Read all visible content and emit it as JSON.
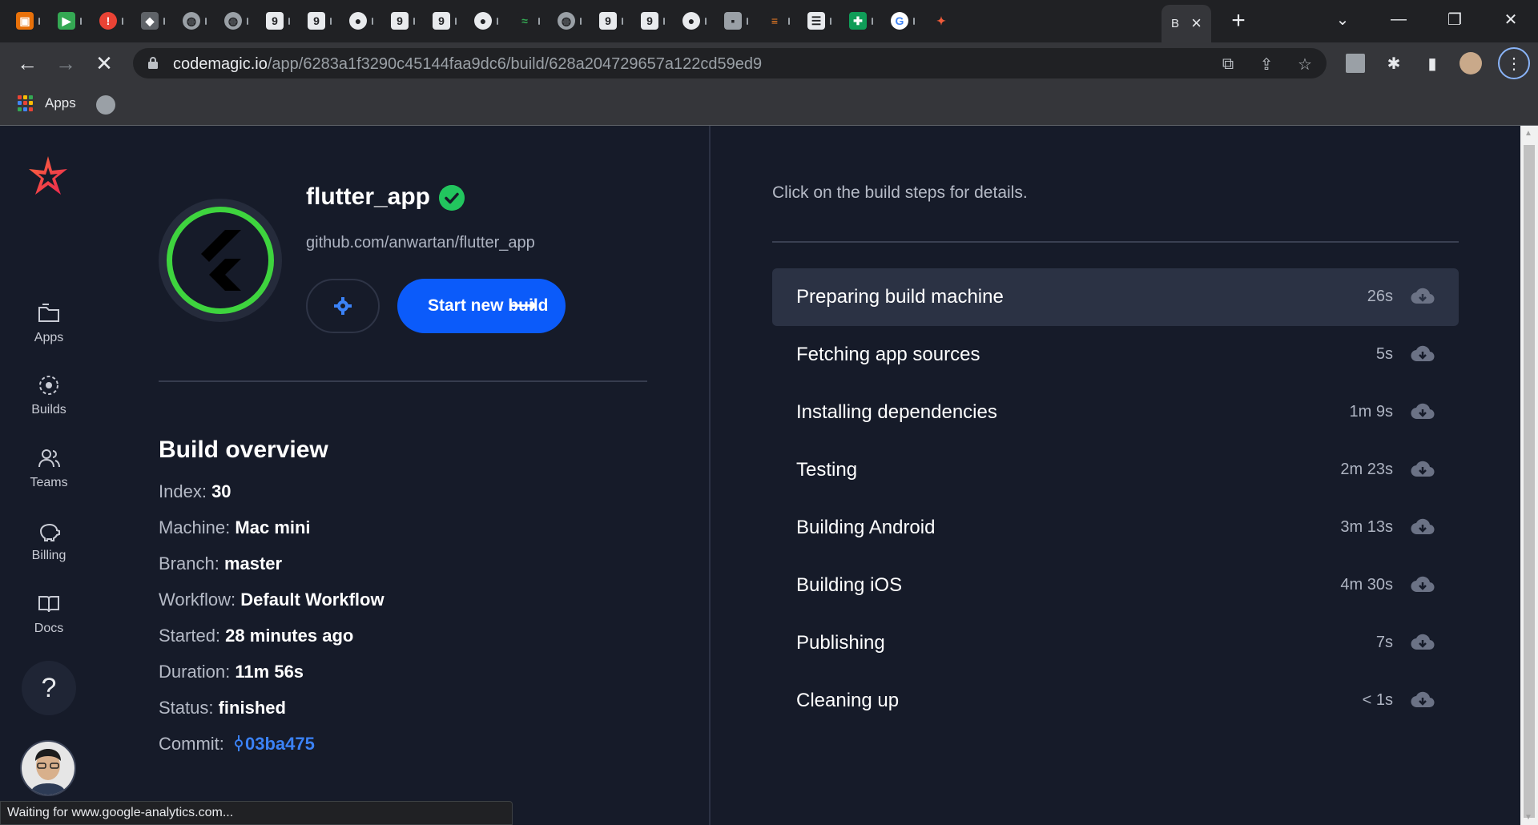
{
  "browser": {
    "active_tab_label": "B",
    "url_host": "codemagic.io",
    "url_path": "/app/6283a1f3290c45144faa9dc6/build/628a204729657a122cd59ed9",
    "bookmarks": {
      "apps_label": "Apps"
    },
    "status_text": "Waiting for www.google-analytics.com..."
  },
  "sidebar": {
    "items": [
      {
        "label": "Apps",
        "icon": "folder-icon"
      },
      {
        "label": "Builds",
        "icon": "builds-icon"
      },
      {
        "label": "Teams",
        "icon": "teams-icon"
      },
      {
        "label": "Billing",
        "icon": "piggy-bank-icon"
      },
      {
        "label": "Docs",
        "icon": "book-icon"
      }
    ],
    "help_label": "?"
  },
  "app": {
    "name": "flutter_app",
    "repo": "github.com/anwartan/flutter_app",
    "start_build_label": "Start new build",
    "start_build_arrow": "⟶"
  },
  "overview": {
    "title": "Build overview",
    "rows": [
      {
        "label": "Index:",
        "value": "30"
      },
      {
        "label": "Machine:",
        "value": "Mac mini"
      },
      {
        "label": "Branch:",
        "value": "master"
      },
      {
        "label": "Workflow:",
        "value": "Default Workflow"
      },
      {
        "label": "Started:",
        "value": "28 minutes ago"
      },
      {
        "label": "Duration:",
        "value": "11m 56s"
      },
      {
        "label": "Status:",
        "value": "finished"
      },
      {
        "label": "Commit:",
        "value": "03ba475"
      }
    ]
  },
  "steps": {
    "hint": "Click on the build steps for details.",
    "items": [
      {
        "label": "Preparing build machine",
        "duration": "26s"
      },
      {
        "label": "Fetching app sources",
        "duration": "5s"
      },
      {
        "label": "Installing dependencies",
        "duration": "1m 9s"
      },
      {
        "label": "Testing",
        "duration": "2m 23s"
      },
      {
        "label": "Building Android",
        "duration": "3m 13s"
      },
      {
        "label": "Building iOS",
        "duration": "4m 30s"
      },
      {
        "label": "Publishing",
        "duration": "7s"
      },
      {
        "label": "Cleaning up",
        "duration": "< 1s"
      }
    ]
  },
  "colors": {
    "accent": "#0b5bfa",
    "success": "#22c55e",
    "page_bg": "#161b29"
  }
}
